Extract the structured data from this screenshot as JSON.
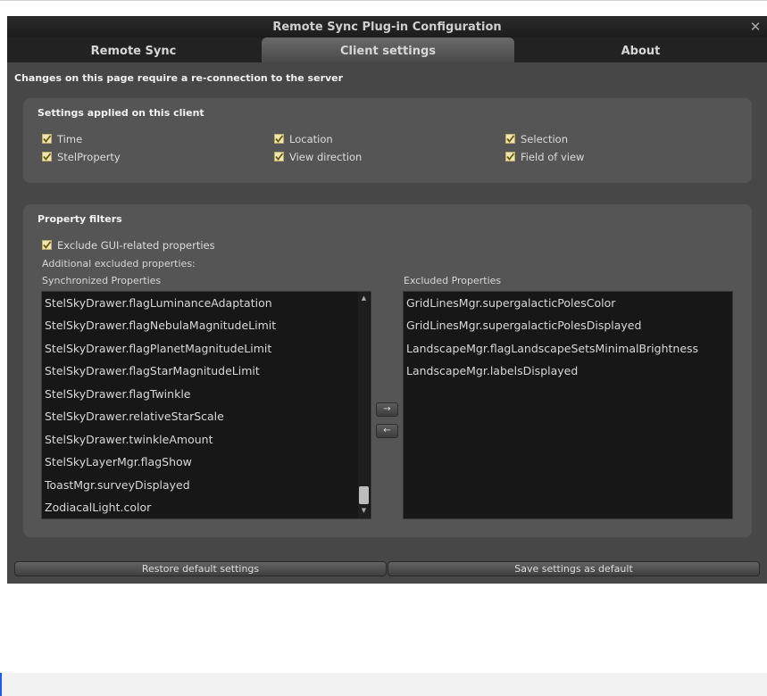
{
  "window": {
    "title": "Remote Sync Plug-in Configuration",
    "close_glyph": "✕"
  },
  "tabs": [
    {
      "label": "Remote Sync",
      "active": false
    },
    {
      "label": "Client settings",
      "active": true
    },
    {
      "label": "About",
      "active": false
    }
  ],
  "notice": "Changes on this page require a re-connection to the server",
  "client_settings": {
    "title": "Settings applied on this client",
    "checkboxes": [
      {
        "label": "Time",
        "checked": true
      },
      {
        "label": "Location",
        "checked": true
      },
      {
        "label": "Selection",
        "checked": true
      },
      {
        "label": "StelProperty",
        "checked": true
      },
      {
        "label": "View direction",
        "checked": true
      },
      {
        "label": "Field of view",
        "checked": true
      }
    ]
  },
  "property_filters": {
    "title": "Property filters",
    "exclude_gui": {
      "label": "Exclude GUI-related properties",
      "checked": true
    },
    "additional_label": "Additional excluded properties:",
    "synchronized_label": "Synchronized Properties",
    "excluded_label": "Excluded Properties",
    "synchronized": [
      "StelSkyDrawer.flagLuminanceAdaptation",
      "StelSkyDrawer.flagNebulaMagnitudeLimit",
      "StelSkyDrawer.flagPlanetMagnitudeLimit",
      "StelSkyDrawer.flagStarMagnitudeLimit",
      "StelSkyDrawer.flagTwinkle",
      "StelSkyDrawer.relativeStarScale",
      "StelSkyDrawer.twinkleAmount",
      "StelSkyLayerMgr.flagShow",
      "ToastMgr.surveyDisplayed",
      "ZodiacalLight.color"
    ],
    "excluded": [
      "GridLinesMgr.supergalacticPolesColor",
      "GridLinesMgr.supergalacticPolesDisplayed",
      "LandscapeMgr.flagLandscapeSetsMinimalBrightness",
      "LandscapeMgr.labelsDisplayed"
    ],
    "move_right_glyph": "→",
    "move_left_glyph": "←",
    "scroll_up_glyph": "▲",
    "scroll_down_glyph": "▼"
  },
  "buttons": {
    "restore": "Restore default settings",
    "save": "Save settings as default"
  },
  "colors": {
    "window_bg": "#474747",
    "group_bg": "#555555",
    "list_bg": "#171717",
    "checkbox_fill": "#f0e7b0",
    "check_mark": "#6b5a10"
  }
}
